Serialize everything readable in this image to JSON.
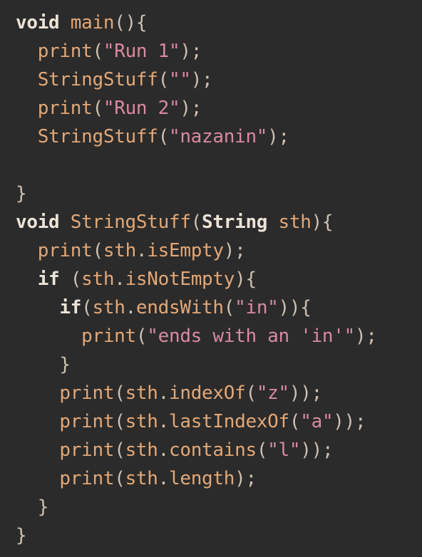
{
  "code": {
    "lines": [
      [
        {
          "t": "kw",
          "v": "void"
        },
        {
          "t": "id",
          "v": " "
        },
        {
          "t": "fn",
          "v": "main"
        },
        {
          "t": "punc",
          "v": "(){"
        }
      ],
      [
        {
          "t": "id",
          "v": "  "
        },
        {
          "t": "fn",
          "v": "print"
        },
        {
          "t": "punc",
          "v": "("
        },
        {
          "t": "str",
          "v": "\"Run 1\""
        },
        {
          "t": "punc",
          "v": ");"
        }
      ],
      [
        {
          "t": "id",
          "v": "  "
        },
        {
          "t": "fn",
          "v": "StringStuff"
        },
        {
          "t": "punc",
          "v": "("
        },
        {
          "t": "str",
          "v": "\"\""
        },
        {
          "t": "punc",
          "v": ");"
        }
      ],
      [
        {
          "t": "id",
          "v": "  "
        },
        {
          "t": "fn",
          "v": "print"
        },
        {
          "t": "punc",
          "v": "("
        },
        {
          "t": "str",
          "v": "\"Run 2\""
        },
        {
          "t": "punc",
          "v": ");"
        }
      ],
      [
        {
          "t": "id",
          "v": "  "
        },
        {
          "t": "fn",
          "v": "StringStuff"
        },
        {
          "t": "punc",
          "v": "("
        },
        {
          "t": "str",
          "v": "\"nazanin\""
        },
        {
          "t": "punc",
          "v": ");"
        }
      ],
      [
        {
          "t": "id",
          "v": ""
        }
      ],
      [
        {
          "t": "punc",
          "v": "}"
        }
      ],
      [
        {
          "t": "kw",
          "v": "void"
        },
        {
          "t": "id",
          "v": " "
        },
        {
          "t": "fn",
          "v": "StringStuff"
        },
        {
          "t": "punc",
          "v": "("
        },
        {
          "t": "type",
          "v": "String"
        },
        {
          "t": "id",
          "v": " "
        },
        {
          "t": "fn",
          "v": "sth"
        },
        {
          "t": "punc",
          "v": "){"
        }
      ],
      [
        {
          "t": "id",
          "v": "  "
        },
        {
          "t": "fn",
          "v": "print"
        },
        {
          "t": "punc",
          "v": "("
        },
        {
          "t": "fn",
          "v": "sth"
        },
        {
          "t": "punc",
          "v": "."
        },
        {
          "t": "fn",
          "v": "isEmpty"
        },
        {
          "t": "punc",
          "v": ");"
        }
      ],
      [
        {
          "t": "id",
          "v": "  "
        },
        {
          "t": "kw",
          "v": "if"
        },
        {
          "t": "id",
          "v": " "
        },
        {
          "t": "punc",
          "v": "("
        },
        {
          "t": "fn",
          "v": "sth"
        },
        {
          "t": "punc",
          "v": "."
        },
        {
          "t": "fn",
          "v": "isNotEmpty"
        },
        {
          "t": "punc",
          "v": "){"
        }
      ],
      [
        {
          "t": "id",
          "v": "    "
        },
        {
          "t": "kw",
          "v": "if"
        },
        {
          "t": "punc",
          "v": "("
        },
        {
          "t": "fn",
          "v": "sth"
        },
        {
          "t": "punc",
          "v": "."
        },
        {
          "t": "fn",
          "v": "endsWith"
        },
        {
          "t": "punc",
          "v": "("
        },
        {
          "t": "str",
          "v": "\"in\""
        },
        {
          "t": "punc",
          "v": ")){"
        }
      ],
      [
        {
          "t": "id",
          "v": "      "
        },
        {
          "t": "fn",
          "v": "print"
        },
        {
          "t": "punc",
          "v": "("
        },
        {
          "t": "str",
          "v": "\"ends with an 'in'\""
        },
        {
          "t": "punc",
          "v": ");"
        }
      ],
      [
        {
          "t": "id",
          "v": "    "
        },
        {
          "t": "punc",
          "v": "}"
        }
      ],
      [
        {
          "t": "id",
          "v": "    "
        },
        {
          "t": "fn",
          "v": "print"
        },
        {
          "t": "punc",
          "v": "("
        },
        {
          "t": "fn",
          "v": "sth"
        },
        {
          "t": "punc",
          "v": "."
        },
        {
          "t": "fn",
          "v": "indexOf"
        },
        {
          "t": "punc",
          "v": "("
        },
        {
          "t": "str",
          "v": "\"z\""
        },
        {
          "t": "punc",
          "v": "));"
        }
      ],
      [
        {
          "t": "id",
          "v": "    "
        },
        {
          "t": "fn",
          "v": "print"
        },
        {
          "t": "punc",
          "v": "("
        },
        {
          "t": "fn",
          "v": "sth"
        },
        {
          "t": "punc",
          "v": "."
        },
        {
          "t": "fn",
          "v": "lastIndexOf"
        },
        {
          "t": "punc",
          "v": "("
        },
        {
          "t": "str",
          "v": "\"a\""
        },
        {
          "t": "punc",
          "v": "));"
        }
      ],
      [
        {
          "t": "id",
          "v": "    "
        },
        {
          "t": "fn",
          "v": "print"
        },
        {
          "t": "punc",
          "v": "("
        },
        {
          "t": "fn",
          "v": "sth"
        },
        {
          "t": "punc",
          "v": "."
        },
        {
          "t": "fn",
          "v": "contains"
        },
        {
          "t": "punc",
          "v": "("
        },
        {
          "t": "str",
          "v": "\"l\""
        },
        {
          "t": "punc",
          "v": "));"
        }
      ],
      [
        {
          "t": "id",
          "v": "    "
        },
        {
          "t": "fn",
          "v": "print"
        },
        {
          "t": "punc",
          "v": "("
        },
        {
          "t": "fn",
          "v": "sth"
        },
        {
          "t": "punc",
          "v": "."
        },
        {
          "t": "fn",
          "v": "length"
        },
        {
          "t": "punc",
          "v": ");"
        }
      ],
      [
        {
          "t": "id",
          "v": "  "
        },
        {
          "t": "punc",
          "v": "}"
        }
      ],
      [
        {
          "t": "punc",
          "v": "}"
        }
      ]
    ]
  },
  "colors": {
    "background": "#2b2b2b",
    "keyword": "#ece3d8",
    "function": "#e3a877",
    "string": "#d98aa0",
    "punctuation": "#cfc1b2"
  }
}
